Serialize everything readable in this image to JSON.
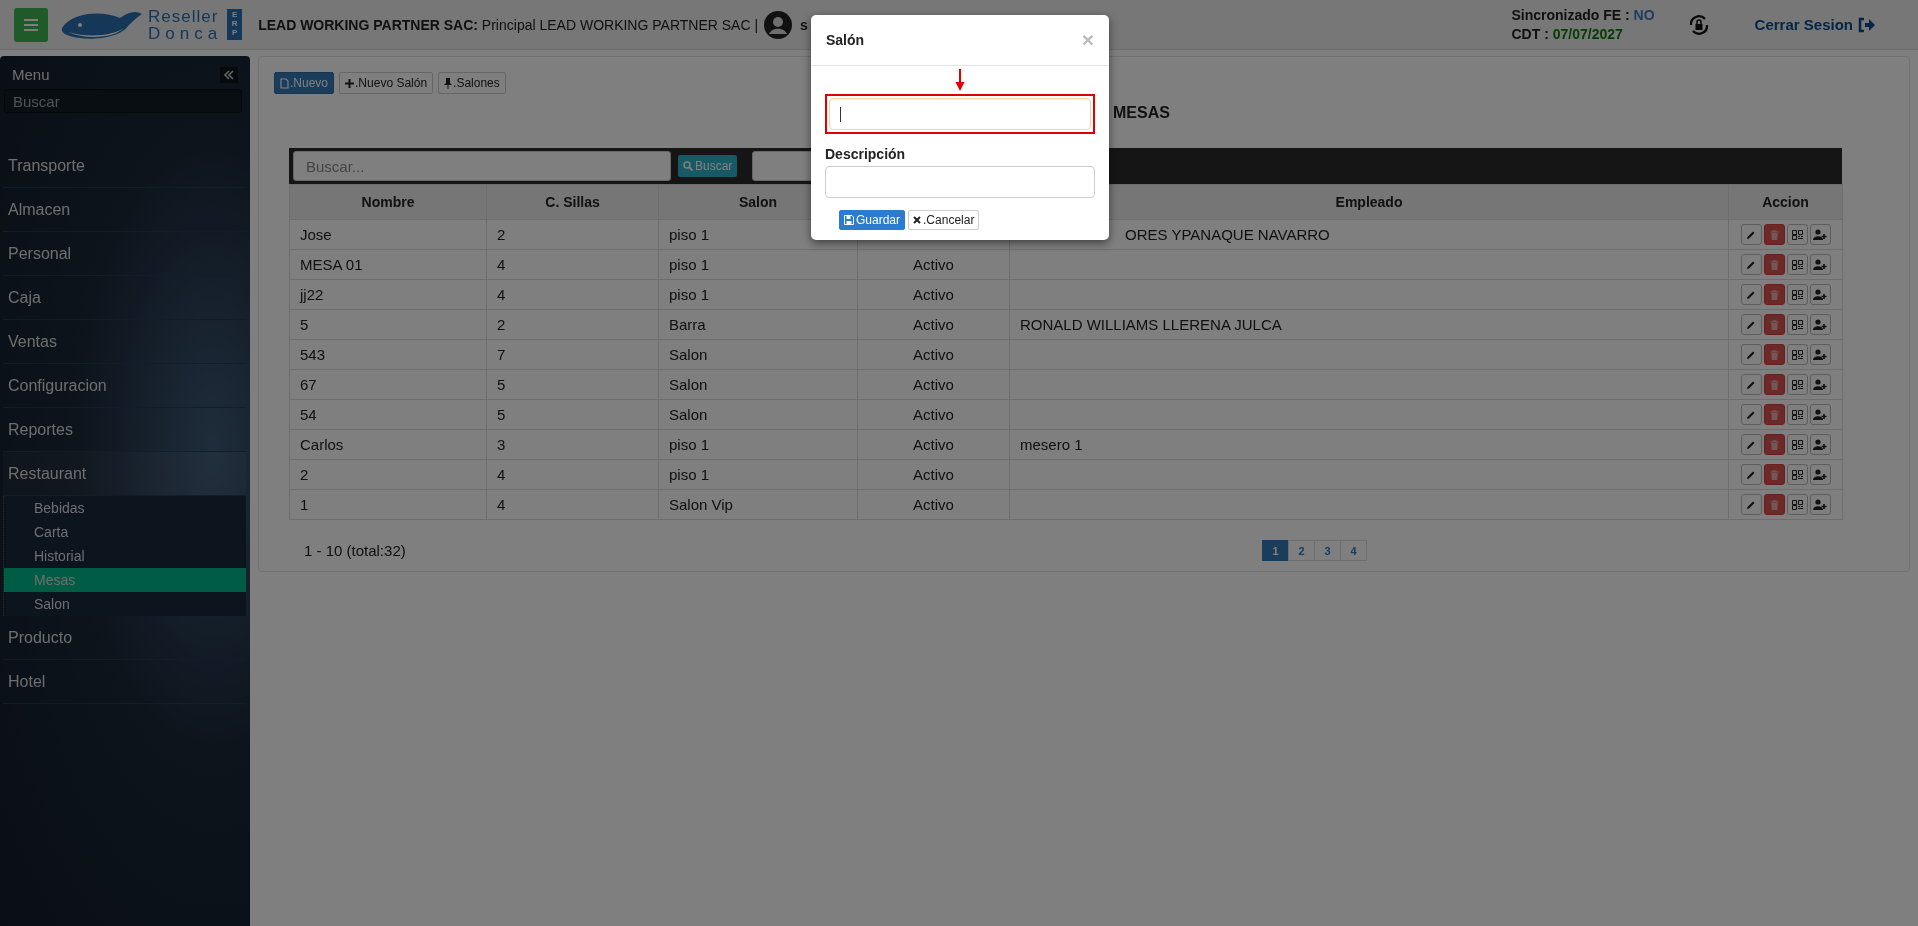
{
  "header": {
    "logo": {
      "line_1": "Reseller",
      "line_2": "Donca",
      "badge": "ERP"
    },
    "company": "**LEAD WORKING PARTNER SAC:** Principal LEAD WORKING PARTNER SAC |",
    "user": "s",
    "sync_label": "Sincronizado FE :",
    "sync_value": "NO",
    "cdt_label": "CDT :",
    "cdt_value": "07/07/2027",
    "logout": "Cerrar Sesion"
  },
  "sidebar": {
    "title": "Menu",
    "search": {
      "placeholder": "Buscar"
    },
    "items": [
      {
        "label": "Transporte"
      },
      {
        "label": "Almacen"
      },
      {
        "label": "Personal"
      },
      {
        "label": "Caja"
      },
      {
        "label": "Ventas"
      },
      {
        "label": "Configuracion"
      },
      {
        "label": "Reportes"
      },
      {
        "label": "Restaurant",
        "children": [
          {
            "label": "Bebidas",
            "selected": false
          },
          {
            "label": "Carta",
            "selected": false
          },
          {
            "label": "Historial",
            "selected": false
          },
          {
            "label": "Mesas",
            "selected": true
          },
          {
            "label": "Salon",
            "selected": false
          }
        ]
      },
      {
        "label": "Producto"
      },
      {
        "label": "Hotel"
      }
    ]
  },
  "toolbar": [
    {
      "label": ".Nuevo",
      "kind": "new"
    },
    {
      "label": ".Nuevo Salón",
      "kind": "add"
    },
    {
      "label": ".Salones",
      "kind": "list"
    }
  ],
  "title": "MESAS",
  "search": {
    "placeholder": "Buscar...",
    "button": "Buscar"
  },
  "table": {
    "columns": [
      {
        "label": "Nombre"
      },
      {
        "label": "C. Sillas"
      },
      {
        "label": "Salon"
      },
      {},
      {
        "label": "Empleado"
      },
      {
        "label": "Accion"
      }
    ],
    "rows": [
      {
        "nombre": "Jose",
        "sillas": "2",
        "salon": "piso 1",
        "empleado": "ORES YPANAQUE NAVARRO"
      },
      {
        "nombre": "MESA 01",
        "sillas": "4",
        "salon": "piso 1",
        "estado": "Activo"
      },
      {
        "nombre": "jj22",
        "sillas": "4",
        "salon": "piso 1",
        "estado": "Activo"
      },
      {
        "nombre": "5",
        "sillas": "2",
        "salon": "Barra",
        "estado": "Activo",
        "empleado": "RONALD WILLIAMS LLERENA JULCA"
      },
      {
        "nombre": "543",
        "sillas": "7",
        "salon": "Salon",
        "estado": "Activo"
      },
      {
        "nombre": "67",
        "sillas": "5",
        "salon": "Salon",
        "estado": "Activo"
      },
      {
        "nombre": "54",
        "sillas": "5",
        "salon": "Salon",
        "estado": "Activo"
      },
      {
        "nombre": "Carlos",
        "sillas": "3",
        "salon": "piso 1",
        "estado": "Activo",
        "empleado": "mesero 1"
      },
      {
        "nombre": "2",
        "sillas": "4",
        "salon": "piso 1",
        "estado": "Activo"
      },
      {
        "nombre": "1",
        "sillas": "4",
        "salon": "Salon Vip",
        "estado": "Activo"
      }
    ]
  },
  "footer": {
    "summary": "1 - 10 (total:32)",
    "pages": [
      {
        "label": "1",
        "selected": true
      },
      {
        "label": "2",
        "selected": false
      },
      {
        "label": "3",
        "selected": false
      },
      {
        "label": "4",
        "selected": false
      }
    ]
  },
  "modal": {
    "title": "Salón",
    "close": "×",
    "fields": [
      {
        "focused": true,
        "highlighted": true
      },
      {
        "label": "Descripción",
        "focused": false,
        "highlighted": false
      }
    ],
    "buttons": [
      {
        "label": "Guardar",
        "kind": "save"
      },
      {
        "label": ".Cancelar",
        "kind": "cancel"
      }
    ]
  }
}
